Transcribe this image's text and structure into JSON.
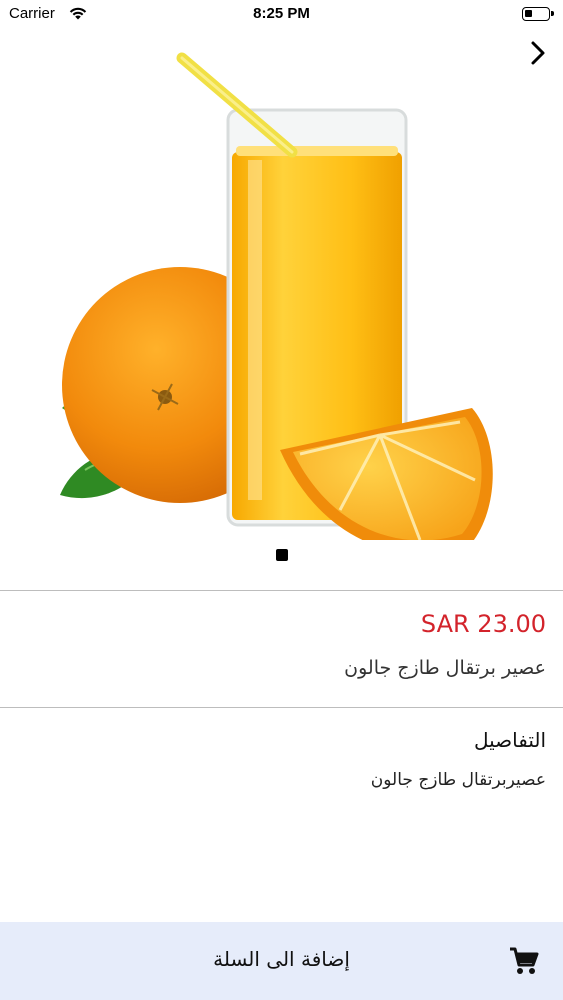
{
  "status_bar": {
    "carrier": "Carrier",
    "time": "8:25 PM"
  },
  "header": {
    "next_icon": "chevron-right-icon"
  },
  "gallery": {
    "image_description_icon": "product-image",
    "page_count": 1,
    "current_page": 1
  },
  "product": {
    "price": "SAR 23.00",
    "name": "عصير برتقال طازج جالون"
  },
  "details": {
    "title": "التفاصيل",
    "text": "عصيربرتقال طازج جالون"
  },
  "cart": {
    "label": "إضافة الى السلة",
    "icon": "shopping-cart-icon"
  },
  "colors": {
    "price": "#d3232b",
    "cart_bar": "#e6ecfa"
  }
}
